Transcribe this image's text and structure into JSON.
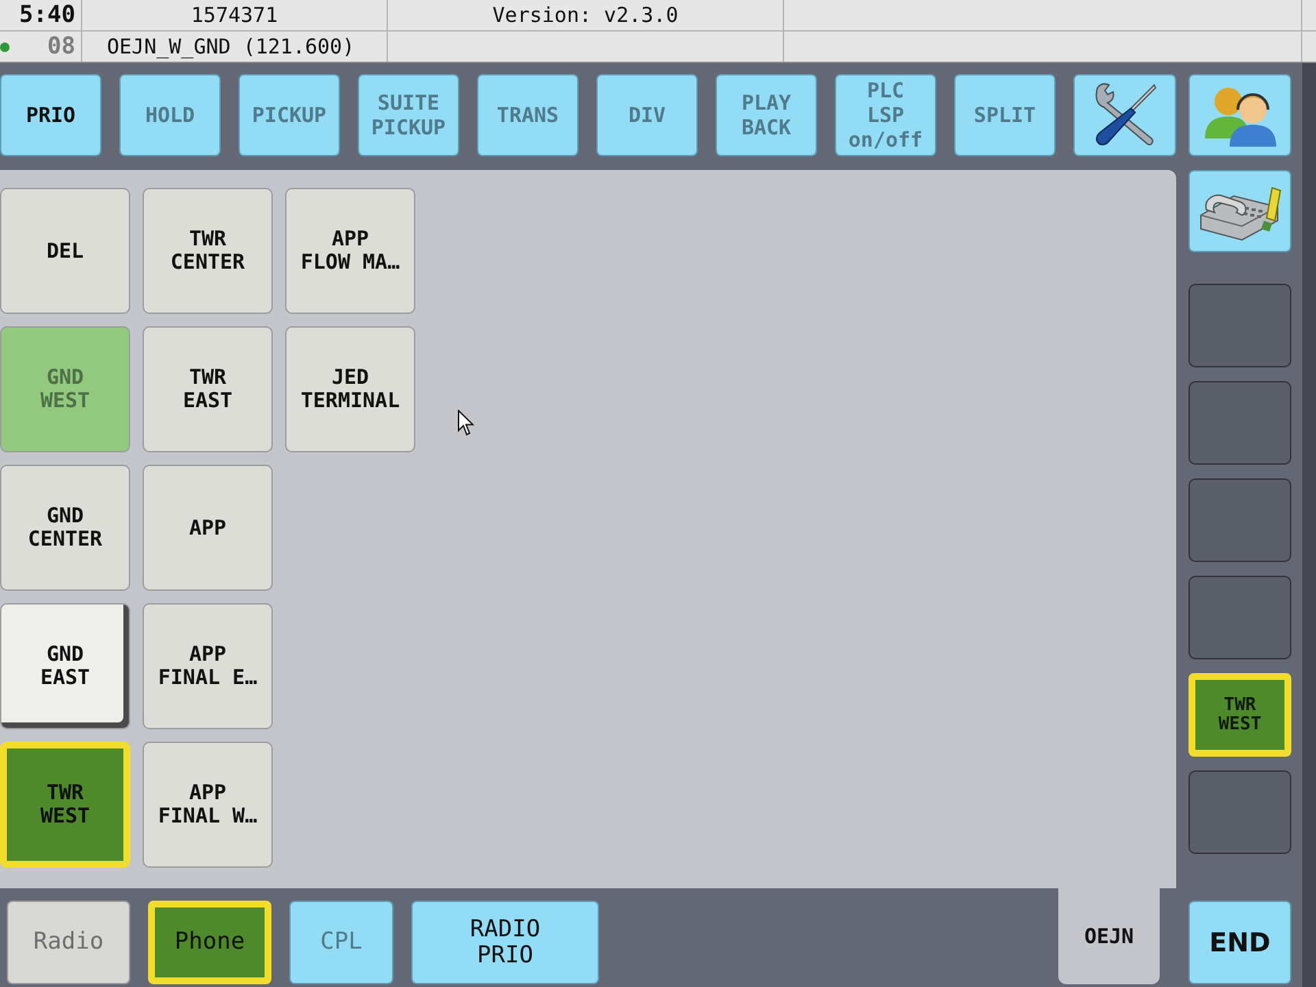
{
  "header": {
    "time": "5:40",
    "seconds": "08",
    "position_id": "1574371",
    "position": "OEJN_W_GND (121.600)",
    "version": "Version: v2.3.0"
  },
  "toolbar": [
    {
      "label": "PRIO",
      "disabled": false
    },
    {
      "label": "HOLD",
      "disabled": true
    },
    {
      "label": "PICKUP",
      "disabled": true
    },
    {
      "label": "SUITE\nPICKUP",
      "disabled": true
    },
    {
      "label": "TRANS",
      "disabled": true
    },
    {
      "label": "DIV",
      "disabled": true
    },
    {
      "label": "PLAY\nBACK",
      "disabled": true
    },
    {
      "label": "PLC\nLSP\non/off",
      "disabled": true
    },
    {
      "label": "SPLIT",
      "disabled": true
    }
  ],
  "grid": {
    "rows": [
      {
        "cells": [
          {
            "label": "DEL",
            "selected": false,
            "standby": false,
            "focused": false
          },
          {
            "label": "TWR\nCENTER",
            "selected": false,
            "standby": false,
            "focused": false
          },
          {
            "label": "APP\nFLOW MA…",
            "selected": false,
            "standby": false,
            "focused": false
          }
        ]
      },
      {
        "cells": [
          {
            "label": "GND\nWEST",
            "selected": false,
            "standby": true,
            "focused": false
          },
          {
            "label": "TWR\nEAST",
            "selected": false,
            "standby": false,
            "focused": false
          },
          {
            "label": "JED\nTERMINAL",
            "selected": false,
            "standby": false,
            "focused": false
          }
        ]
      },
      {
        "cells": [
          {
            "label": "GND\nCENTER",
            "selected": false,
            "standby": false,
            "focused": false
          },
          {
            "label": "APP",
            "selected": false,
            "standby": false,
            "focused": false
          }
        ]
      },
      {
        "cells": [
          {
            "label": "GND\nEAST",
            "selected": false,
            "standby": false,
            "focused": true
          },
          {
            "label": "APP\nFINAL E…",
            "selected": false,
            "standby": false,
            "focused": false
          }
        ]
      },
      {
        "cells": [
          {
            "label": "TWR\nWEST",
            "selected": true,
            "standby": false,
            "focused": false
          },
          {
            "label": "APP\nFINAL W…",
            "selected": false,
            "standby": false,
            "focused": false
          }
        ]
      }
    ]
  },
  "modes": [
    {
      "kind": "toggle",
      "label": "Radio",
      "selected": false,
      "disabled": false
    },
    {
      "kind": "toggle",
      "label": "Phone",
      "selected": true,
      "disabled": false
    },
    {
      "kind": "button",
      "label": "CPL",
      "selected": false,
      "disabled": true
    },
    {
      "kind": "button",
      "label": "RADIO\nPRIO",
      "selected": false,
      "disabled": false
    }
  ],
  "tabs": [
    {
      "label": "OEJN",
      "selected": true
    }
  ],
  "slots": [
    {
      "active": false
    },
    {
      "active": false
    },
    {
      "active": false
    },
    {
      "active": false
    },
    {
      "active": true,
      "label": "TWR\nWEST"
    },
    {
      "active": false
    }
  ],
  "end_button": {
    "label": "END"
  }
}
